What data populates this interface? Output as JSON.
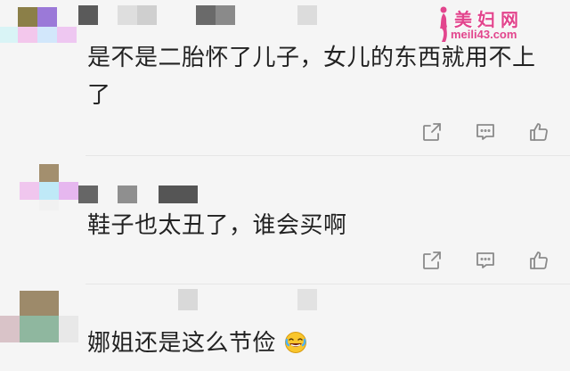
{
  "watermark": {
    "title": "美妇网",
    "url": "meili43.com"
  },
  "comments": [
    {
      "text": "是不是二胎怀了儿子，女儿的东西就用不上了"
    },
    {
      "text": "鞋子也太丑了，谁会买啊"
    },
    {
      "text": "娜姐还是这么节俭",
      "emoji": "laughing-crying-emoji"
    }
  ],
  "actions": {
    "forward_icon": "share-icon",
    "reply_icon": "comment-icon",
    "like_icon": "thumbs-up-icon"
  }
}
